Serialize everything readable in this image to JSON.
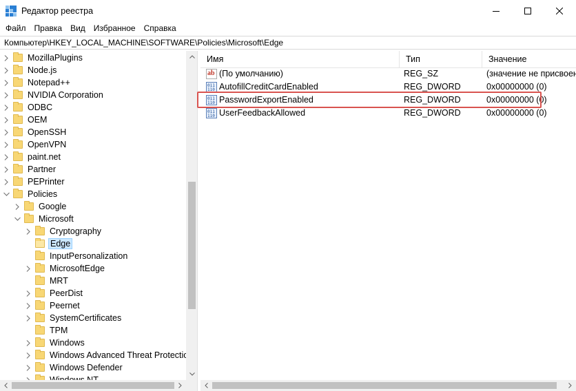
{
  "window": {
    "title": "Редактор реестра",
    "controls": [
      "minimize",
      "maximize",
      "close"
    ]
  },
  "menu": {
    "items": [
      "Файл",
      "Правка",
      "Вид",
      "Избранное",
      "Справка"
    ]
  },
  "address": {
    "path": "Компьютер\\HKEY_LOCAL_MACHINE\\SOFTWARE\\Policies\\Microsoft\\Edge"
  },
  "tree": {
    "items": [
      {
        "label": "MozillaPlugins",
        "level": 0,
        "expander": "collapsed"
      },
      {
        "label": "Node.js",
        "level": 0,
        "expander": "collapsed"
      },
      {
        "label": "Notepad++",
        "level": 0,
        "expander": "collapsed"
      },
      {
        "label": "NVIDIA Corporation",
        "level": 0,
        "expander": "collapsed"
      },
      {
        "label": "ODBC",
        "level": 0,
        "expander": "collapsed"
      },
      {
        "label": "OEM",
        "level": 0,
        "expander": "collapsed"
      },
      {
        "label": "OpenSSH",
        "level": 0,
        "expander": "collapsed"
      },
      {
        "label": "OpenVPN",
        "level": 0,
        "expander": "collapsed"
      },
      {
        "label": "paint.net",
        "level": 0,
        "expander": "collapsed"
      },
      {
        "label": "Partner",
        "level": 0,
        "expander": "collapsed"
      },
      {
        "label": "PEPrinter",
        "level": 0,
        "expander": "collapsed"
      },
      {
        "label": "Policies",
        "level": 0,
        "expander": "expanded"
      },
      {
        "label": "Google",
        "level": 1,
        "expander": "collapsed"
      },
      {
        "label": "Microsoft",
        "level": 1,
        "expander": "expanded"
      },
      {
        "label": "Cryptography",
        "level": 2,
        "expander": "collapsed"
      },
      {
        "label": "Edge",
        "level": 2,
        "expander": "none",
        "selected": true
      },
      {
        "label": "InputPersonalization",
        "level": 2,
        "expander": "none"
      },
      {
        "label": "MicrosoftEdge",
        "level": 2,
        "expander": "collapsed"
      },
      {
        "label": "MRT",
        "level": 2,
        "expander": "none"
      },
      {
        "label": "PeerDist",
        "level": 2,
        "expander": "collapsed"
      },
      {
        "label": "Peernet",
        "level": 2,
        "expander": "collapsed"
      },
      {
        "label": "SystemCertificates",
        "level": 2,
        "expander": "collapsed"
      },
      {
        "label": "TPM",
        "level": 2,
        "expander": "none"
      },
      {
        "label": "Windows",
        "level": 2,
        "expander": "collapsed"
      },
      {
        "label": "Windows Advanced Threat Protection",
        "level": 2,
        "expander": "collapsed"
      },
      {
        "label": "Windows Defender",
        "level": 2,
        "expander": "collapsed"
      },
      {
        "label": "Windows NT",
        "level": 2,
        "expander": "collapsed"
      }
    ]
  },
  "values": {
    "columns": {
      "name": "Имя",
      "type": "Тип",
      "data": "Значение"
    },
    "rows": [
      {
        "icon": "string-value-icon",
        "name": "(По умолчанию)",
        "type": "REG_SZ",
        "data": "(значение не присвоено)"
      },
      {
        "icon": "dword-value-icon",
        "name": "AutofillCreditCardEnabled",
        "type": "REG_DWORD",
        "data": "0x00000000 (0)"
      },
      {
        "icon": "dword-value-icon",
        "name": "PasswordExportEnabled",
        "type": "REG_DWORD",
        "data": "0x00000000 (0)",
        "highlighted": true
      },
      {
        "icon": "dword-value-icon",
        "name": "UserFeedbackAllowed",
        "type": "REG_DWORD",
        "data": "0x00000000 (0)"
      }
    ]
  },
  "colors": {
    "highlight_border": "#d9534f",
    "selection_bg": "#cce8ff",
    "folder": "#f8d775"
  }
}
